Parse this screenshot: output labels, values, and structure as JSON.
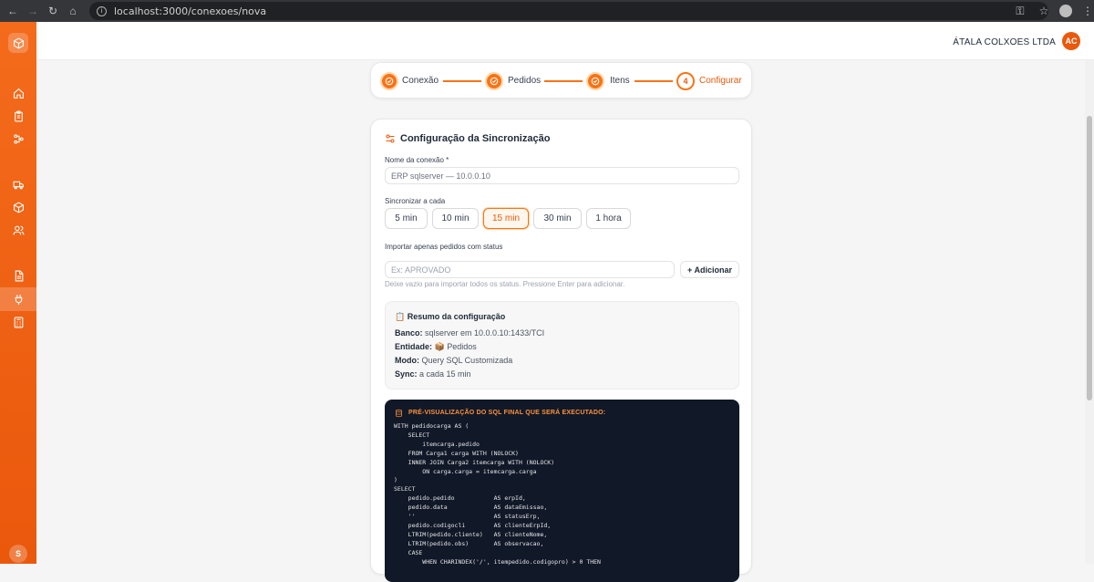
{
  "browser": {
    "url": "localhost:3000/conexoes/nova"
  },
  "header": {
    "company": "ÁTALA COLXOES LTDA",
    "user_initials": "AC"
  },
  "sidebar": {
    "user_initial": "S",
    "items": [
      {
        "name": "home-icon"
      },
      {
        "name": "clipboard-icon"
      },
      {
        "name": "workflow-icon"
      },
      {
        "name": "truck-icon"
      },
      {
        "name": "box-icon"
      },
      {
        "name": "users-icon"
      },
      {
        "name": "document-icon"
      },
      {
        "name": "plug-icon",
        "active": true
      },
      {
        "name": "calculator-icon"
      }
    ]
  },
  "stepper": {
    "steps": [
      {
        "label": "Conexão",
        "status": "done"
      },
      {
        "label": "Pedidos",
        "status": "done"
      },
      {
        "label": "Itens",
        "status": "done"
      },
      {
        "label": "Configurar",
        "status": "current",
        "number": "4"
      }
    ]
  },
  "config": {
    "title": "Configuração da Sincronização",
    "name_label": "Nome da conexão *",
    "name_value": "ERP sqlserver — 10.0.0.10",
    "sync_label": "Sincronizar a cada",
    "sync_options": [
      "5 min",
      "10 min",
      "15 min",
      "30 min",
      "1 hora"
    ],
    "sync_selected": "15 min",
    "status_label": "Importar apenas pedidos com status",
    "status_placeholder": "Ex: APROVADO",
    "add_button": "+ Adicionar",
    "hint": "Deixe vazio para importar todos os status. Pressione Enter para adicionar."
  },
  "summary": {
    "title": "📋 Resumo da configuração",
    "banco_key": "Banco:",
    "banco_val": " sqlserver em 10.0.0.10:1433/TCI",
    "entidade_key": "Entidade:",
    "entidade_val": " 📦 Pedidos",
    "modo_key": "Modo:",
    "modo_val": " Query SQL Customizada",
    "sync_key": "Sync:",
    "sync_val": " a cada 15 min"
  },
  "sql_preview": {
    "title": "PRÉ-VISUALIZAÇÃO DO SQL FINAL QUE SERÁ EXECUTADO:",
    "code": "WITH pedidocarga AS (\n    SELECT\n        itemcarga.pedido\n    FROM Carga1 carga WITH (NOLOCK)\n    INNER JOIN Carga2 itemcarga WITH (NOLOCK)\n        ON carga.carga = itemcarga.carga\n)\nSELECT\n    pedido.pedido           AS erpId,\n    pedido.data             AS dataEmissao,\n    ''                      AS statusErp,\n    pedido.codigocli        AS clienteErpId,\n    LTRIM(pedido.cliente)   AS clienteNome,\n    LTRIM(pedido.obs)       AS observacao,\n    CASE\n        WHEN CHARINDEX('/', itempedido.codigopro) > 0 THEN"
  }
}
